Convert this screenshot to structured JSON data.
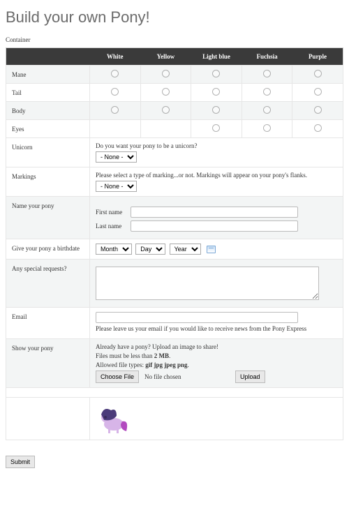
{
  "page_title": "Build your own Pony!",
  "container_label": "Container",
  "color_headers": [
    "White",
    "Yellow",
    "Light blue",
    "Fuchsia",
    "Purple"
  ],
  "grid_rows": [
    {
      "label": "Mane",
      "alt": true,
      "cells": [
        true,
        true,
        true,
        true,
        true
      ]
    },
    {
      "label": "Tail",
      "alt": false,
      "cells": [
        true,
        true,
        true,
        true,
        true
      ]
    },
    {
      "label": "Body",
      "alt": true,
      "cells": [
        true,
        true,
        true,
        true,
        true
      ]
    },
    {
      "label": "Eyes",
      "alt": false,
      "cells": [
        false,
        false,
        true,
        true,
        true
      ]
    }
  ],
  "unicorn": {
    "label": "Unicorn",
    "help": "Do you want your pony to be a unicorn?",
    "select_value": "- None -"
  },
  "markings": {
    "label": "Markings",
    "help": "Please select a type of marking...or not. Markings will appear on your pony's flanks.",
    "select_value": "- None -"
  },
  "name_section": {
    "label": "Name your pony",
    "first_label": "First name",
    "last_label": "Last name"
  },
  "birthdate": {
    "label": "Give your pony a birthdate",
    "month": "Month",
    "day": "Day",
    "year": "Year"
  },
  "requests": {
    "label": "Any special requests?"
  },
  "email": {
    "label": "Email",
    "help": "Please leave us your email if you would like to receive news from the Pony Express"
  },
  "upload": {
    "label": "Show your pony",
    "line1": "Already have a pony? Upload an image to share!",
    "line2_prefix": "Files must be less than ",
    "line2_bold": "2 MB",
    "line2_suffix": ".",
    "line3_prefix": "Allowed file types: ",
    "line3_bold": "gif jpg jpeg png",
    "line3_suffix": ".",
    "choose_btn": "Choose File",
    "no_file": "No file chosen",
    "upload_btn": "Upload"
  },
  "submit_label": "Submit"
}
